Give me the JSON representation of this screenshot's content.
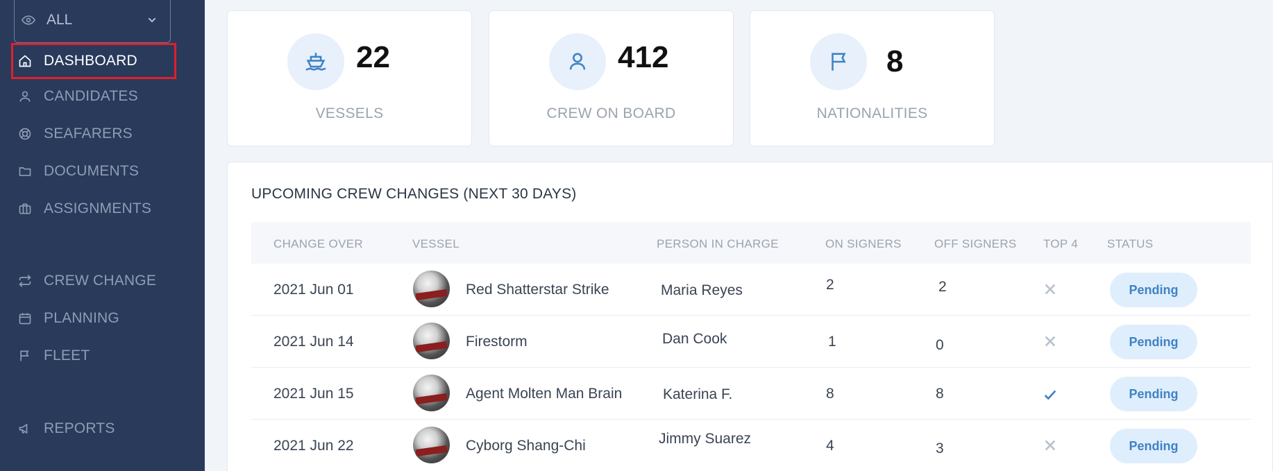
{
  "sidebar": {
    "filter": {
      "label": "ALL",
      "eye_icon": "eye-icon",
      "chevron_icon": "chevron-down-icon"
    },
    "items": [
      {
        "label": "DASHBOARD",
        "icon": "home-icon",
        "active": true
      },
      {
        "label": "CANDIDATES",
        "icon": "user-icon"
      },
      {
        "label": "SEAFARERS",
        "icon": "lifebuoy-icon"
      },
      {
        "label": "DOCUMENTS",
        "icon": "folder-icon"
      },
      {
        "label": "ASSIGNMENTS",
        "icon": "briefcase-icon"
      },
      {
        "label": "CREW CHANGE",
        "icon": "repeat-icon"
      },
      {
        "label": "PLANNING",
        "icon": "calendar-icon"
      },
      {
        "label": "FLEET",
        "icon": "flag-icon"
      },
      {
        "label": "REPORTS",
        "icon": "megaphone-icon"
      }
    ]
  },
  "stats": [
    {
      "value": "22",
      "label": "VESSELS",
      "icon": "ship-icon"
    },
    {
      "value": "412",
      "label": "CREW ON BOARD",
      "icon": "user-icon"
    },
    {
      "value": "8",
      "label": "NATIONALITIES",
      "icon": "flag-icon"
    }
  ],
  "crew_changes": {
    "title": "UPCOMING CREW CHANGES (NEXT 30 DAYS)",
    "columns": [
      "CHANGE OVER",
      "VESSEL",
      "PERSON IN CHARGE",
      "ON SIGNERS",
      "OFF SIGNERS",
      "TOP 4",
      "STATUS"
    ],
    "rows": [
      {
        "change_over": "2021 Jun 01",
        "vessel": "Red Shatterstar Strike",
        "person": "Maria Reyes",
        "on_signers": "2",
        "off_signers": "2",
        "top4": "x-icon",
        "status": "Pending"
      },
      {
        "change_over": "2021 Jun 14",
        "vessel": "Firestorm",
        "person": "Dan Cook",
        "on_signers": "1",
        "off_signers": "0",
        "top4": "x-icon",
        "status": "Pending"
      },
      {
        "change_over": "2021 Jun 15",
        "vessel": "Agent Molten Man Brain",
        "person": "Katerina F.",
        "on_signers": "8",
        "off_signers": "8",
        "top4": "check-icon",
        "status": "Pending"
      },
      {
        "change_over": "2021 Jun 22",
        "vessel": "Cyborg Shang-Chi",
        "person": "Jimmy Suarez",
        "on_signers": "4",
        "off_signers": "3",
        "top4": "x-icon",
        "status": "Pending"
      }
    ]
  },
  "colors": {
    "sidebar_bg": "#293a5b",
    "accent": "#3f82c5",
    "active_outline": "#e0202a",
    "badge_bg": "#dfeefc"
  }
}
